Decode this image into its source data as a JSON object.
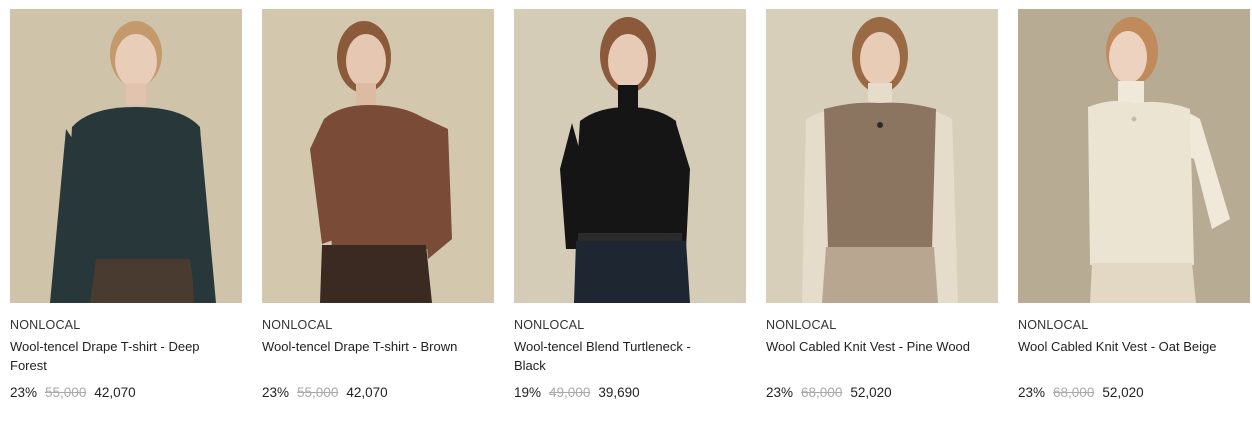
{
  "products": [
    {
      "brand": "NONLOCAL",
      "name": "Wool-tencel Drape T-shirt - Deep Forest",
      "discount": "23%",
      "original_price": "55,000",
      "price": "42,070",
      "colors": {
        "bg": "#cfc3a9",
        "garment": "#27373a",
        "bottom": "#4a3b30",
        "hair": "#c49a6c"
      }
    },
    {
      "brand": "NONLOCAL",
      "name": "Wool-tencel Drape T-shirt - Brown",
      "discount": "23%",
      "original_price": "55,000",
      "price": "42,070",
      "colors": {
        "bg": "#d3c8ae",
        "garment": "#7a4c37",
        "bottom": "#3a2a22",
        "hair": "#8a5a3a"
      }
    },
    {
      "brand": "NONLOCAL",
      "name": "Wool-tencel Blend Turtleneck - Black",
      "discount": "19%",
      "original_price": "49,000",
      "price": "39,690",
      "colors": {
        "bg": "#d5ccb7",
        "garment": "#151515",
        "bottom": "#1e2632",
        "hair": "#8a5a3a"
      }
    },
    {
      "brand": "NONLOCAL",
      "name": "Wool Cabled Knit Vest - Pine Wood",
      "discount": "23%",
      "original_price": "68,000",
      "price": "52,020",
      "colors": {
        "bg": "#d8cfbb",
        "garment": "#8c7560",
        "bottom": "#b8a690",
        "hair": "#9a6a44"
      }
    },
    {
      "brand": "NONLOCAL",
      "name": "Wool Cabled Knit Vest - Oat Beige",
      "discount": "23%",
      "original_price": "68,000",
      "price": "52,020",
      "colors": {
        "bg": "#b8ab94",
        "garment": "#ece4d2",
        "bottom": "#e2d8c4",
        "hair": "#c08a5a"
      }
    }
  ]
}
